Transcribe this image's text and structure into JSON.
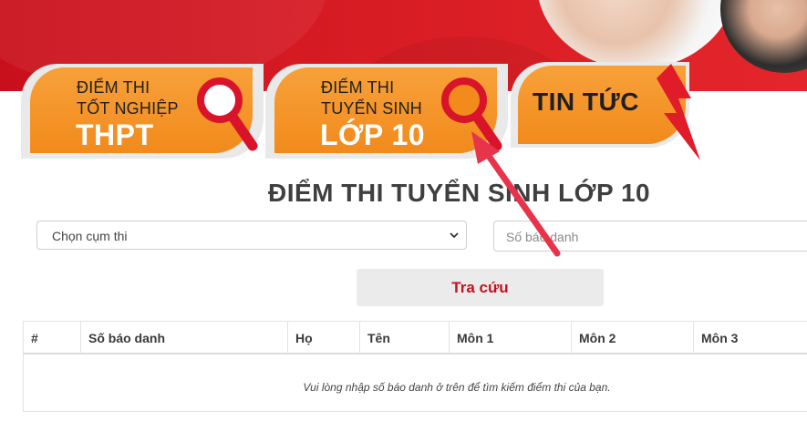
{
  "tabs": [
    {
      "line1": "ĐIỂM THI",
      "line2": "TỐT NGHIỆP",
      "big": "THPT"
    },
    {
      "line1": "ĐIỂM THI",
      "line2": "TUYỂN SINH",
      "big": "LỚP 10"
    },
    {
      "label": "TIN TỨC"
    }
  ],
  "page_title": "ĐIỂM THI TUYỂN SINH LỚP 10",
  "form": {
    "cluster_select_value": "Chọn cụm thi",
    "candidate_id_placeholder": "Số báo danh",
    "search_button": "Tra cứu"
  },
  "table": {
    "headers": [
      "#",
      "Số báo danh",
      "Họ",
      "Tên",
      "Môn 1",
      "Môn 2",
      "Môn 3"
    ],
    "empty_message": "Vui lòng nhập số báo danh ở trên để tìm kiếm điểm thi của bạn."
  },
  "colors": {
    "brand_red": "#c8101c",
    "tab_orange": "#f28a1c",
    "arrow_red": "#e8344a"
  },
  "icons": [
    "magnifier-icon",
    "lightning-icon",
    "chevron-down-icon",
    "annotation-arrow-icon"
  ]
}
